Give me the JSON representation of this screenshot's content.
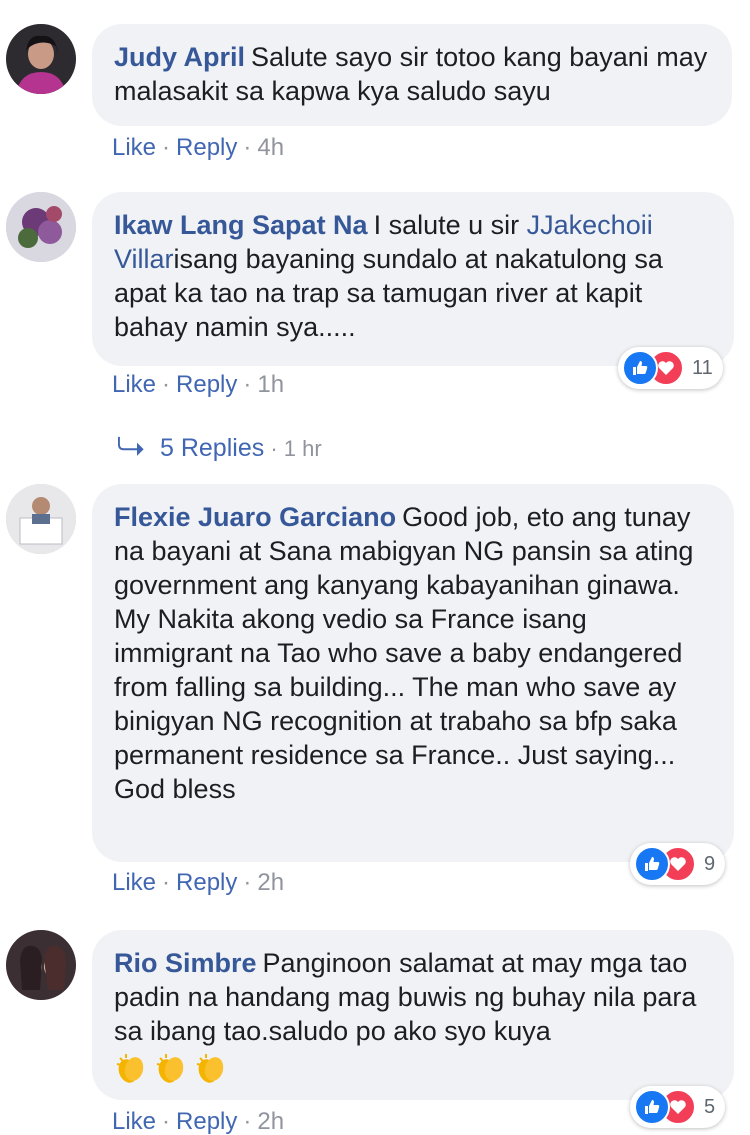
{
  "comments": [
    {
      "author": "Judy April",
      "text": "Salute sayo sir totoo kang bayani may malasakit sa kapwa kya saludo sayu",
      "like": "Like",
      "reply": "Reply",
      "time": "4h"
    },
    {
      "author": "Ikaw Lang Sapat Na",
      "text_before": "I salute u sir ",
      "mention": "JJakechoii Villar",
      "text_after": "isang bayaning sundalo at nakatulong sa apat ka tao na trap sa tamugan river at kapit bahay namin sya.....",
      "like": "Like",
      "reply": "Reply",
      "time": "1h",
      "reaction_count": "11"
    },
    {
      "author": "Flexie Juaro Garciano",
      "text_line1": "Good job, eto ang tunay na bayani at Sana mabigyan NG pansin sa ating government ang kanyang kabayanihan ginawa.",
      "text_line2": "My Nakita akong vedio sa France isang immigrant na Tao who save a baby endangered from falling sa building... The man who save ay binigyan NG recognition at trabaho sa bfp saka permanent residence sa France.. Just saying... God bless",
      "like": "Like",
      "reply": "Reply",
      "time": "2h",
      "reaction_count": "9"
    },
    {
      "author": "Rio Simbre",
      "text": "Panginoon salamat at may mga tao padin na handang mag buwis ng buhay nila para sa ibang tao.saludo po ako syo kuya",
      "like": "Like",
      "reply": "Reply",
      "time": "2h",
      "reaction_count": "5"
    }
  ],
  "replies_link": {
    "label": "5 Replies",
    "time": "1 hr"
  },
  "colors": {
    "author": "#365899",
    "link": "#4267b2",
    "bubble": "#f0f2f5",
    "like": "#1877f2",
    "love": "#f33e58"
  },
  "icons": [
    "reply-arrow-icon",
    "like-reaction-icon",
    "love-reaction-icon",
    "clapping-hands-emoji"
  ]
}
